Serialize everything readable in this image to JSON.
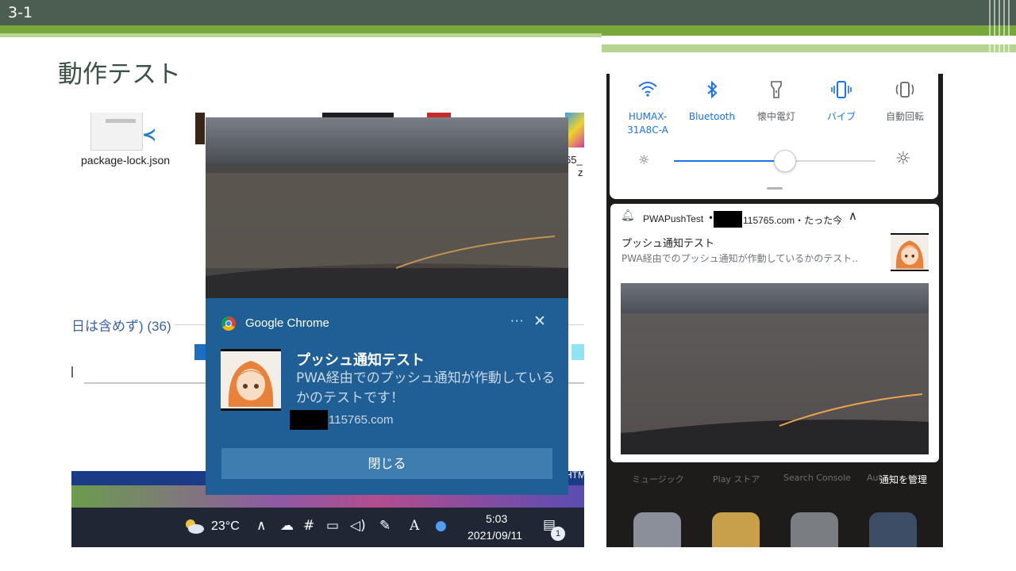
{
  "slide": {
    "number": "3-1",
    "title": "動作テスト"
  },
  "windows_screenshot": {
    "desktop_file": {
      "label": "package-lock.json",
      "icon": "vscode-file-icon"
    },
    "explorer_fragment_text": "日は含めず) (36)",
    "right_edge_fragment": [
      "65_",
      "z"
    ],
    "desktop_edge_fragment": "HTM",
    "toast": {
      "app_name": "Google Chrome",
      "more_glyph": "···",
      "close_glyph": "✕",
      "title": "プッシュ通知テスト",
      "body": "PWA経由でのプッシュ通知が作動しているかのテストです！",
      "domain": "115765.com",
      "button_label": "閉じる"
    },
    "taskbar": {
      "temperature": "23°C",
      "time": "5:03",
      "date": "2021/09/11",
      "notification_count": "1",
      "tray_icons": [
        "weather-icon",
        "chevron-up-icon",
        "onedrive-icon",
        "slack-icon",
        "network-icon",
        "volume-icon",
        "pen-icon",
        "ime-icon",
        "browser-icon",
        "notification-center-icon"
      ],
      "ime_glyph": "A"
    }
  },
  "android_screenshot": {
    "quick_settings": [
      {
        "label": "HUMAX-\n31A8C-A",
        "icon": "wifi-icon",
        "active": true
      },
      {
        "label": "Bluetooth",
        "icon": "bluetooth-icon",
        "active": true
      },
      {
        "label": "懐中電灯",
        "icon": "flashlight-icon",
        "active": false
      },
      {
        "label": "バイブ",
        "icon": "vibrate-icon",
        "active": true
      },
      {
        "label": "自動回転",
        "icon": "auto-rotate-icon",
        "active": false
      }
    ],
    "brightness_level": 0.55,
    "notification": {
      "app_name": "PWAPushTest",
      "domain_and_time": "115765.com・たった今",
      "title": "プッシュ通知テスト",
      "body": "PWA経由でのプッシュ通知が作動しているかのテスト..",
      "expanded": true
    },
    "home_labels": [
      "ミュージック",
      "Play ストア",
      "Search Console",
      "Aut"
    ],
    "manage_label": "通知を管理"
  },
  "colors": {
    "slide_header": "#4c5e52",
    "slide_accent": "#78a83c",
    "title_color": "#3d5246",
    "toast_bg": "#1f5f95",
    "toast_button": "#3f7cb0",
    "android_accent": "#1a73e8"
  }
}
